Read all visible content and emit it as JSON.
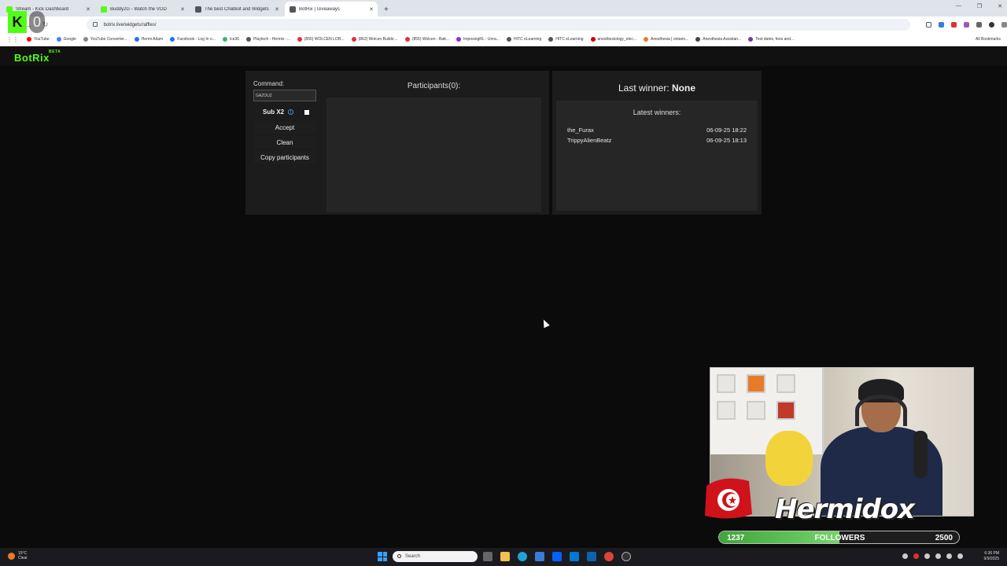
{
  "browser": {
    "tabs": [
      {
        "title": "Stream - Kick Dashboard",
        "color": "#53fc18"
      },
      {
        "title": "Buddy2G - Watch the VOD",
        "color": "#53fc18"
      },
      {
        "title": "The best ChatBot and Widgets",
        "color": "#555555"
      },
      {
        "title": "BotRix | Giveaways",
        "color": "#555555"
      }
    ],
    "url": "botrix.live/widgets/raffles/",
    "bookmarks": [
      {
        "label": "YouTube",
        "color": "#ff0000"
      },
      {
        "label": "Google",
        "color": "#4285f4"
      },
      {
        "label": "YouTube Converter...",
        "color": "#888888"
      },
      {
        "label": "Hermi Adam",
        "color": "#1877f2"
      },
      {
        "label": "Facebook - Log In o...",
        "color": "#1877f2"
      },
      {
        "label": "Ice36",
        "color": "#3cb371"
      },
      {
        "label": "Playtech - Hermix -...",
        "color": "#555555"
      },
      {
        "label": "(855) WOLCEN LOR...",
        "color": "#d33"
      },
      {
        "label": "(862) Wolcen Builds:...",
        "color": "#d33"
      },
      {
        "label": "(855) Wolcen - Batt...",
        "color": "#d33"
      },
      {
        "label": "ImposingRL - Unra...",
        "color": "#8a2be2"
      },
      {
        "label": "HITC eLearning",
        "color": "#555555"
      },
      {
        "label": "HITC eLearning",
        "color": "#555555"
      },
      {
        "label": "anesthesiology_elec...",
        "color": "#c00"
      },
      {
        "label": "Anesthesia | ontario...",
        "color": "#e87b2a"
      },
      {
        "label": "Anesthesia Assistan...",
        "color": "#444444"
      },
      {
        "label": "Test dates, fees and...",
        "color": "#6a3fa0"
      }
    ],
    "all_bookmarks": "All Bookmarks"
  },
  "site": {
    "logo": "BotRix",
    "logo_badge": "BETA",
    "command_label": "Command:",
    "command_value": "GAZOUZ",
    "sub_label": "Sub X2",
    "info_icon": "ⓘ",
    "buttons": {
      "accept": "Accept",
      "clean": "Clean",
      "copy": "Copy participants"
    },
    "participants_title": "Participants(0):",
    "last_winner_label": "Last winner: ",
    "last_winner_value": "None",
    "latest_winners_title": "Latest winners:",
    "winners": [
      {
        "name": "the_Furax",
        "date": "06-09-25 18:22"
      },
      {
        "name": "TrippyAlienBeatz",
        "date": "06-09-25 18:13"
      }
    ],
    "accent": "#53fc18"
  },
  "overlay": {
    "kick_letter": "K",
    "kick_count": "0",
    "streamer_name": "Hermidox",
    "followers_current": "1237",
    "followers_label": "FOLLOWERS",
    "followers_goal": "2500",
    "followers_progress": 0.5
  },
  "taskbar": {
    "weather_temp": "15°C",
    "weather_cond": "Clear",
    "search_placeholder": "Search",
    "time": "6:36 PM",
    "date": "9/9/2025"
  }
}
